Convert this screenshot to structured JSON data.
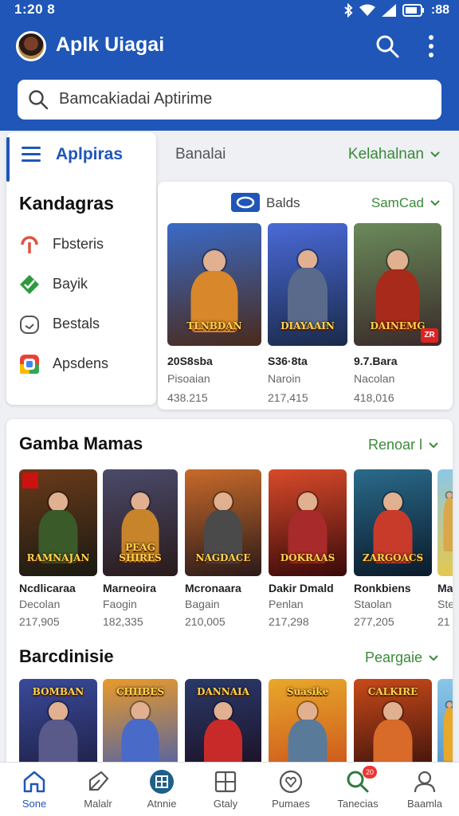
{
  "status": {
    "time": "1:20 8",
    "battery": ":88"
  },
  "header": {
    "title": "Aplk Uiagai",
    "avatar_icon": "avatar-icon",
    "search_icon": "search-icon",
    "more_icon": "more-vert-icon"
  },
  "search": {
    "value": "Bamcakiadai Aptirime"
  },
  "menu": {
    "brand": "Aplpiras",
    "heading": "Kandagras",
    "items": [
      {
        "label": "Fbsteris",
        "icon": "pin-icon",
        "color": "#e0533d"
      },
      {
        "label": "Bayik",
        "icon": "check-shield-icon",
        "color": "#2e9a3e"
      },
      {
        "label": "Bestals",
        "icon": "clock-icon",
        "color": "#555555"
      },
      {
        "label": "Apsdens",
        "icon": "chrome-icon",
        "color": "#4285f4"
      }
    ]
  },
  "tabs": {
    "left": "Banalai",
    "right": "Kelahalnan"
  },
  "featured": {
    "label": "Balds",
    "sort": "SamCad",
    "games": [
      {
        "title": "20S8sba",
        "sub": "Pisoaian",
        "count": "438.215",
        "cover_text": "TLNBDAN",
        "bg1": "#3a6bc8",
        "bg2": "#4a2a1a",
        "hero": "#d8872a"
      },
      {
        "title": "S36·8ta",
        "sub": "Naroin",
        "count": "217,415",
        "cover_text": "DIAYAAIN",
        "bg1": "#4a6ad8",
        "bg2": "#1a2a4a",
        "hero": "#5a6a8a"
      },
      {
        "title": "9.7.Bara",
        "sub": "Nacolan",
        "count": "418,016",
        "cover_text": "DAINEMG",
        "bg1": "#6a8a5a",
        "bg2": "#3a2a2a",
        "hero": "#a82a1a"
      }
    ]
  },
  "section1": {
    "title": "Gamba Mamas",
    "link": "Renoar l",
    "games": [
      {
        "title": "Ncdlicaraa",
        "sub": "Decolan",
        "count": "217,905",
        "cover_text": "RAMNAJAN",
        "bg1": "#6a3a1a",
        "bg2": "#1a1a12",
        "hero": "#3a5a2a"
      },
      {
        "title": "Marneoira",
        "sub": "Faogin",
        "count": "182,335",
        "cover_text": "PEAG SHIRES",
        "bg1": "#4a4a6a",
        "bg2": "#2a1a1a",
        "hero": "#c8842a"
      },
      {
        "title": "Mcronaara",
        "sub": "Bagain",
        "count": "210,005",
        "cover_text": "NAGDACE",
        "bg1": "#c86a2a",
        "bg2": "#2a1a1a",
        "hero": "#4a4a4a"
      },
      {
        "title": "Dakir Dmald",
        "sub": "Penlan",
        "count": "217,298",
        "cover_text": "DOKRAAS",
        "bg1": "#d84a2a",
        "bg2": "#3a0a0a",
        "hero": "#a82a2a"
      },
      {
        "title": "Ronkbiens",
        "sub": "Staolan",
        "count": "277,205",
        "cover_text": "ZARGOACS",
        "bg1": "#2a6a8a",
        "bg2": "#0a1a2a",
        "hero": "#c83a2a"
      },
      {
        "title": "Ma",
        "sub": "Ste",
        "count": "21",
        "cover_text": "",
        "bg1": "#8ac8e8",
        "bg2": "#e8c84a",
        "hero": "#d8a84a"
      }
    ]
  },
  "section2": {
    "title": "Barcdinisie",
    "link": "Peargaie",
    "games": [
      {
        "cover_text": "BOMBAN",
        "bg1": "#3a4a9a",
        "bg2": "#1a1a3a",
        "hero": "#5a5a8a"
      },
      {
        "cover_text": "CHIIBES",
        "bg1": "#e89a2a",
        "bg2": "#3a5ab8",
        "hero": "#4a6ac8"
      },
      {
        "cover_text": "DANNAIA",
        "bg1": "#2a3a6a",
        "bg2": "#1a0a1a",
        "hero": "#c82a2a"
      },
      {
        "cover_text": "Suasike",
        "bg1": "#e8a82a",
        "bg2": "#c84a1a",
        "hero": "#5a7a9a"
      },
      {
        "cover_text": "CALKIRE",
        "bg1": "#c84a1a",
        "bg2": "#2a0a0a",
        "hero": "#d86a2a"
      },
      {
        "cover_text": "",
        "bg1": "#8ac8e8",
        "bg2": "#4a8ac8",
        "hero": "#e8a82a"
      }
    ]
  },
  "nav": {
    "active": 0,
    "items": [
      {
        "label": "Sone",
        "icon": "home-icon"
      },
      {
        "label": "Malalr",
        "icon": "tag-icon"
      },
      {
        "label": "Atnnie",
        "icon": "grid-icon"
      },
      {
        "label": "Gtaly",
        "icon": "window-icon"
      },
      {
        "label": "Pumaes",
        "icon": "heart-face-icon"
      },
      {
        "label": "Tanecias",
        "icon": "search-icon",
        "badge": "20"
      },
      {
        "label": "Baamla",
        "icon": "person-icon"
      }
    ]
  }
}
